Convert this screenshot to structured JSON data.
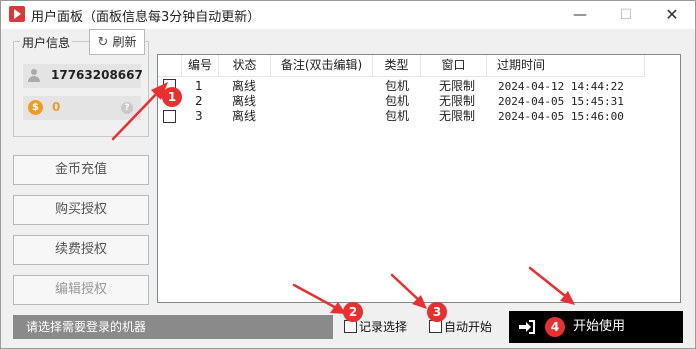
{
  "window": {
    "title": "用户面板（面板信息每3分钟自动更新）",
    "controls": {
      "minimize": "—",
      "maximize": "☐",
      "close": "✕"
    }
  },
  "user_info": {
    "legend": "用户信息",
    "refresh_label": "刷新",
    "phone": "17763208667",
    "coins": "0"
  },
  "side_buttons": {
    "recharge": "金币充值",
    "buy_license": "购买授权",
    "renew_license": "续费授权",
    "edit_license": "编辑授权"
  },
  "table": {
    "columns": [
      "编号",
      "状态",
      "备注(双击编辑)",
      "类型",
      "窗口",
      "过期时间"
    ],
    "rows": [
      {
        "id": "1",
        "status": "离线",
        "note": "",
        "type": "包机",
        "window": "无限制",
        "expires": "2024-04-12 14:44:22"
      },
      {
        "id": "2",
        "status": "离线",
        "note": "",
        "type": "包机",
        "window": "无限制",
        "expires": "2024-04-05 15:45:31"
      },
      {
        "id": "3",
        "status": "离线",
        "note": "",
        "type": "包机",
        "window": "无限制",
        "expires": "2024-04-05 15:46:00"
      }
    ]
  },
  "footer": {
    "status_text": "请选择需要登录的机器",
    "remember_label": "记录选择",
    "autostart_label": "自动开始",
    "start_label": "开始使用"
  },
  "annotations": [
    "1",
    "2",
    "3",
    "4"
  ],
  "colors": {
    "accent_red": "#e83030",
    "coin_orange": "#f29c1f",
    "start_bg": "#000000"
  }
}
